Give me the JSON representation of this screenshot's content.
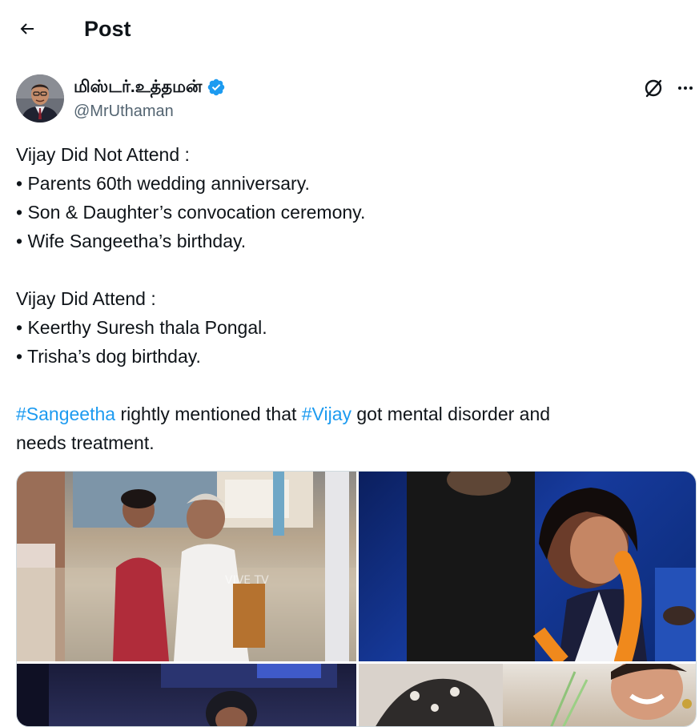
{
  "header": {
    "title": "Post",
    "back_icon": "arrow-left-icon"
  },
  "author": {
    "display_name": "மிஸ்டர்.உத்தமன்",
    "handle": "@MrUthaman",
    "verified_icon": "verified-badge-icon",
    "verified_color": "#1d9bf0"
  },
  "actions": {
    "grok_icon": "grok-icon",
    "more_icon": "more-icon"
  },
  "tweet": {
    "lines": [
      "Vijay Did Not Attend :",
      "• Parents 60th wedding anniversary.",
      "• Son & Daughter’s convocation ceremony.",
      "• Wife Sangeetha’s birthday.",
      "",
      "Vijay Did Attend :",
      "• Keerthy Suresh thala Pongal.",
      "• Trisha’s dog birthday.",
      ""
    ],
    "hashtag1": "#Sangeetha",
    "text1": " rightly mentioned that ",
    "hashtag2": "#Vijay",
    "text2": " got mental disorder and",
    "last_line": "needs treatment."
  },
  "media": {
    "watermark": "VIVE TV"
  },
  "colors": {
    "text": "#0f1419",
    "secondary": "#536471",
    "link": "#1d9bf0"
  }
}
